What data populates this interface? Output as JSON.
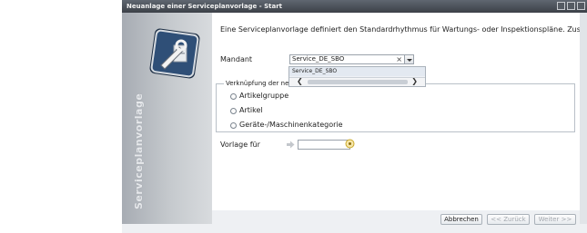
{
  "window": {
    "title": "Neuanlage einer Serviceplanvorlage - Start"
  },
  "sidebar": {
    "vertical_title": "Serviceplanvorlage",
    "icon": "wrench-tools-icon"
  },
  "content": {
    "intro_text": "Eine Serviceplanvorlage definiert den Standardrhythmus für Wartungs- oder Inspektionspläne. Zusätzlich werden Ei",
    "mandant": {
      "label": "Mandant",
      "value": "Service_DE_SBO",
      "clear_glyph": "×",
      "dropdown_options": [
        "Service_DE_SBO"
      ]
    },
    "link_group": {
      "legend": "Verknüpfung der neue",
      "options": [
        "Artikelgruppe",
        "Artikel",
        "Geräte-/Maschinenkategorie"
      ]
    },
    "vorlage": {
      "label": "Vorlage für",
      "value": ""
    }
  },
  "footer": {
    "buttons": {
      "cancel": "Abbrechen",
      "back": "<< Zurück",
      "next": "Weiter >>"
    }
  },
  "colors": {
    "titlebar": "#4a5058",
    "sidebar": "#bfc3c8",
    "icon_tile": "#2f4f77",
    "accent_arrow": "#c9a82a"
  }
}
